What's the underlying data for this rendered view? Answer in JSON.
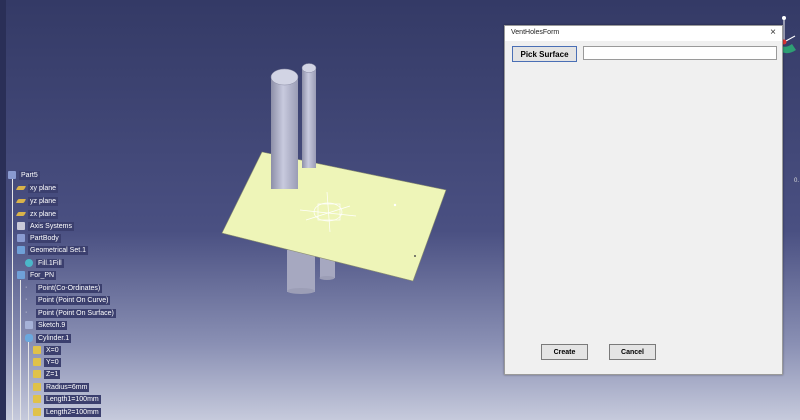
{
  "dialog": {
    "title": "VentHolesForm",
    "close_glyph": "×",
    "pick_surface_label": "Pick Surface",
    "surface_value": "",
    "create_label": "Create",
    "cancel_label": "Cancel"
  },
  "tree": {
    "items": [
      {
        "label": "Part5",
        "icon": "part-icon"
      },
      {
        "label": "xy plane",
        "icon": "plane-icon"
      },
      {
        "label": "yz plane",
        "icon": "plane-icon"
      },
      {
        "label": "zx plane",
        "icon": "plane-icon"
      },
      {
        "label": "Axis Systems",
        "icon": "axis-icon"
      },
      {
        "label": "PartBody",
        "icon": "body-icon"
      },
      {
        "label": "Geometrical Set.1",
        "icon": "geoset-icon"
      },
      {
        "label": "Fill.1Fill",
        "icon": "fill-icon"
      },
      {
        "label": "For_PN",
        "icon": "geoset-icon"
      },
      {
        "label": "Point(Co-Ordinates)",
        "icon": "point-icon"
      },
      {
        "label": "Point (Point On Curve)",
        "icon": "point-icon"
      },
      {
        "label": "Point (Point On Surface)",
        "icon": "point-icon"
      },
      {
        "label": "Sketch.9",
        "icon": "sketch-icon"
      },
      {
        "label": "Cylinder.1",
        "icon": "cylinder-icon"
      },
      {
        "label": "X=0",
        "icon": "parameter-icon"
      },
      {
        "label": "Y=0",
        "icon": "parameter-icon"
      },
      {
        "label": "Z=1",
        "icon": "parameter-icon"
      },
      {
        "label": "Radius=6mm",
        "icon": "parameter-icon"
      },
      {
        "label": "Length1=100mm",
        "icon": "parameter-icon"
      },
      {
        "label": "Length2=100mm",
        "icon": "parameter-icon"
      }
    ]
  },
  "viewport": {
    "plane_color": "#eef5b8",
    "cylinder_color": "#b4b6cc"
  },
  "compass": {
    "icon": "compass-icon"
  },
  "corner_text": "0."
}
